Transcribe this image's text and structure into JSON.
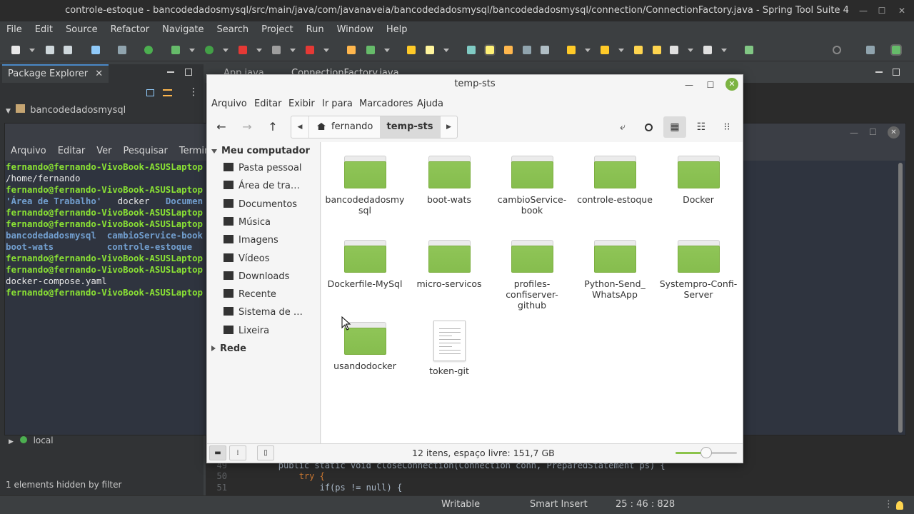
{
  "eclipse": {
    "window_title": "controle-estoque - bancodedadosmysql/src/main/java/com/javanaveia/bancodedadosmysql/bancodedadosmysql/connection/ConnectionFactory.java - Spring Tool Suite 4",
    "menu": [
      "File",
      "Edit",
      "Source",
      "Refactor",
      "Navigate",
      "Search",
      "Project",
      "Run",
      "Window",
      "Help"
    ],
    "package_explorer": {
      "tab_label": "Package Explorer",
      "close_glyph": "✕",
      "project": "bancodedadosmysql",
      "server": "local",
      "filter_status": "1 elements hidden by filter"
    },
    "editor_tabs": [
      "App.java",
      "ConnectionFactory.java"
    ],
    "code": [
      {
        "num": "49",
        "text": "public static void closeConnection(Connection conn, PreparedStatement ps) {"
      },
      {
        "num": "50",
        "text": "try {"
      },
      {
        "num": "51",
        "text": "if(ps != null) {"
      }
    ],
    "status": {
      "mode": "Writable",
      "insert": "Smart Insert",
      "position": "25 : 46 : 828"
    }
  },
  "terminal": {
    "menu": [
      "Arquivo",
      "Editar",
      "Ver",
      "Pesquisar",
      "Terminal"
    ],
    "lines": [
      [
        {
          "t": "fernando@fernando-VivoBook-ASUSLaptop",
          "c": "g"
        }
      ],
      [
        {
          "t": "/home/fernando",
          "c": "w"
        }
      ],
      [
        {
          "t": "fernando@fernando-VivoBook-ASUSLaptop",
          "c": "g"
        }
      ],
      [
        {
          "t": "'Área de Trabalho'",
          "c": "b"
        },
        {
          "t": "   docker   ",
          "c": "w"
        },
        {
          "t": "Documen",
          "c": "b"
        }
      ],
      [
        {
          "t": "fernando@fernando-VivoBook-ASUSLaptop",
          "c": "g"
        }
      ],
      [
        {
          "t": "fernando@fernando-VivoBook-ASUSLaptop",
          "c": "g"
        }
      ],
      [
        {
          "t": "bancodedadosmysql  cambioService-book",
          "c": "b"
        }
      ],
      [
        {
          "t": "boot-wats          controle-estoque",
          "c": "b"
        }
      ],
      [
        {
          "t": "fernando@fernando-VivoBook-ASUSLaptop",
          "c": "g"
        }
      ],
      [
        {
          "t": "fernando@fernando-VivoBook-ASUSLaptop",
          "c": "g"
        }
      ],
      [
        {
          "t": "docker-compose.yaml",
          "c": "w"
        }
      ],
      [
        {
          "t": "fernando@fernando-VivoBook-ASUSLaptop",
          "c": "g"
        }
      ]
    ]
  },
  "file_manager": {
    "title": "temp-sts",
    "menu": [
      "Arquivo",
      "Editar",
      "Exibir",
      "Ir para",
      "Marcadores",
      "Ajuda"
    ],
    "breadcrumb": {
      "home": "fernando",
      "current": "temp-sts"
    },
    "sidebar": {
      "computer_header": "Meu computador",
      "items": [
        {
          "label": "Pasta pessoal",
          "icon": "home-icon"
        },
        {
          "label": "Área de tra…",
          "icon": "desktop-icon"
        },
        {
          "label": "Documentos",
          "icon": "document-icon"
        },
        {
          "label": "Música",
          "icon": "music-icon"
        },
        {
          "label": "Imagens",
          "icon": "camera-icon"
        },
        {
          "label": "Vídeos",
          "icon": "film-icon"
        },
        {
          "label": "Downloads",
          "icon": "download-icon"
        },
        {
          "label": "Recente",
          "icon": "clock-icon"
        },
        {
          "label": "Sistema de …",
          "icon": "drive-icon"
        },
        {
          "label": "Lixeira",
          "icon": "trash-icon"
        }
      ],
      "network_header": "Rede"
    },
    "items": [
      {
        "name": "bancodedadosmy\nsql",
        "type": "folder"
      },
      {
        "name": "boot-wats",
        "type": "folder"
      },
      {
        "name": "cambioService-\nbook",
        "type": "folder"
      },
      {
        "name": "controle-estoque",
        "type": "folder"
      },
      {
        "name": "Docker",
        "type": "folder"
      },
      {
        "name": "Dockerfile-MySql",
        "type": "folder"
      },
      {
        "name": "micro-servicos",
        "type": "folder"
      },
      {
        "name": "profiles-\nconfiserver-\ngithub",
        "type": "folder"
      },
      {
        "name": "Python-Send_\nWhatsApp",
        "type": "folder"
      },
      {
        "name": "Systempro-Confi-\nServer",
        "type": "folder"
      },
      {
        "name": "usandodocker",
        "type": "folder"
      },
      {
        "name": "token-git",
        "type": "file"
      }
    ],
    "status_text": "12 itens, espaço livre: 151,7 GB",
    "zoom_level": 0.5,
    "colors": {
      "folder": "#8bc34a",
      "accent": "#7cb342"
    }
  }
}
